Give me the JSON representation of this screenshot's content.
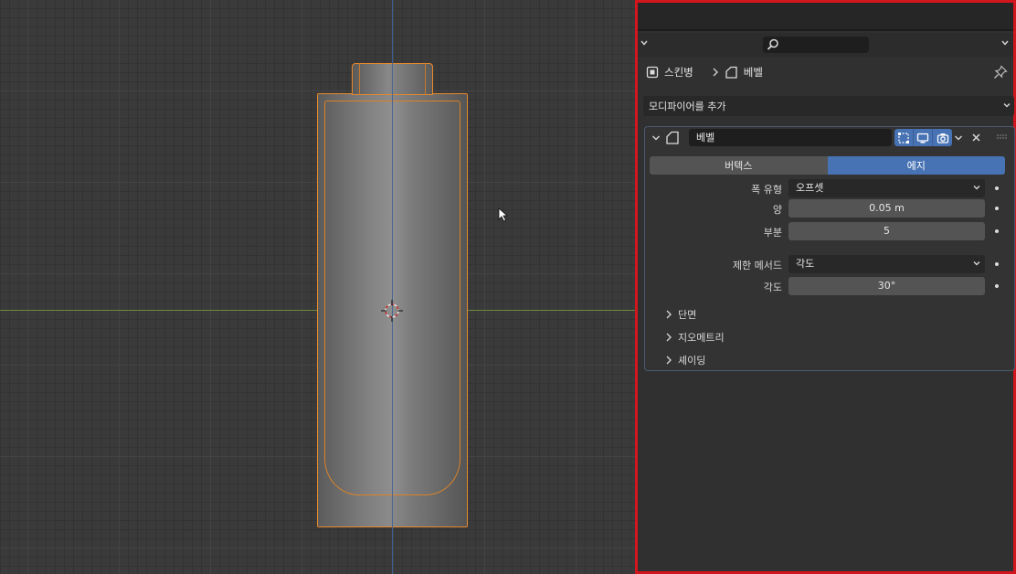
{
  "breadcrumb": {
    "object_label": "스킨병",
    "modifier_label": "베벨"
  },
  "add_modifier": {
    "label": "모디파이어를 추가"
  },
  "modifier": {
    "name": "베벨",
    "affect_tabs": [
      "버텍스",
      "에지"
    ],
    "active_tab": "에지",
    "width_type": {
      "label": "폭 유형",
      "value": "오프셋"
    },
    "amount": {
      "label": "양",
      "value": "0.05 m"
    },
    "segments": {
      "label": "부분",
      "value": "5"
    },
    "limit_method": {
      "label": "제한 메서드",
      "value": "각도"
    },
    "angle": {
      "label": "각도",
      "value": "30°"
    },
    "subpanels": [
      "단면",
      "지오메트리",
      "셰이딩"
    ]
  },
  "colors": {
    "selection_outline": "#e8892a",
    "active_blue": "#4772b3",
    "highlight_border": "#d2161e"
  },
  "icons": [
    "search-icon",
    "object-icon",
    "bevel-modifier-icon",
    "pin-icon",
    "edit-mode-icon",
    "viewport-icon",
    "render-icon",
    "close-icon",
    "chevron-down-icon",
    "chevron-right-icon",
    "3d-cursor-icon",
    "mouse-pointer-icon"
  ]
}
